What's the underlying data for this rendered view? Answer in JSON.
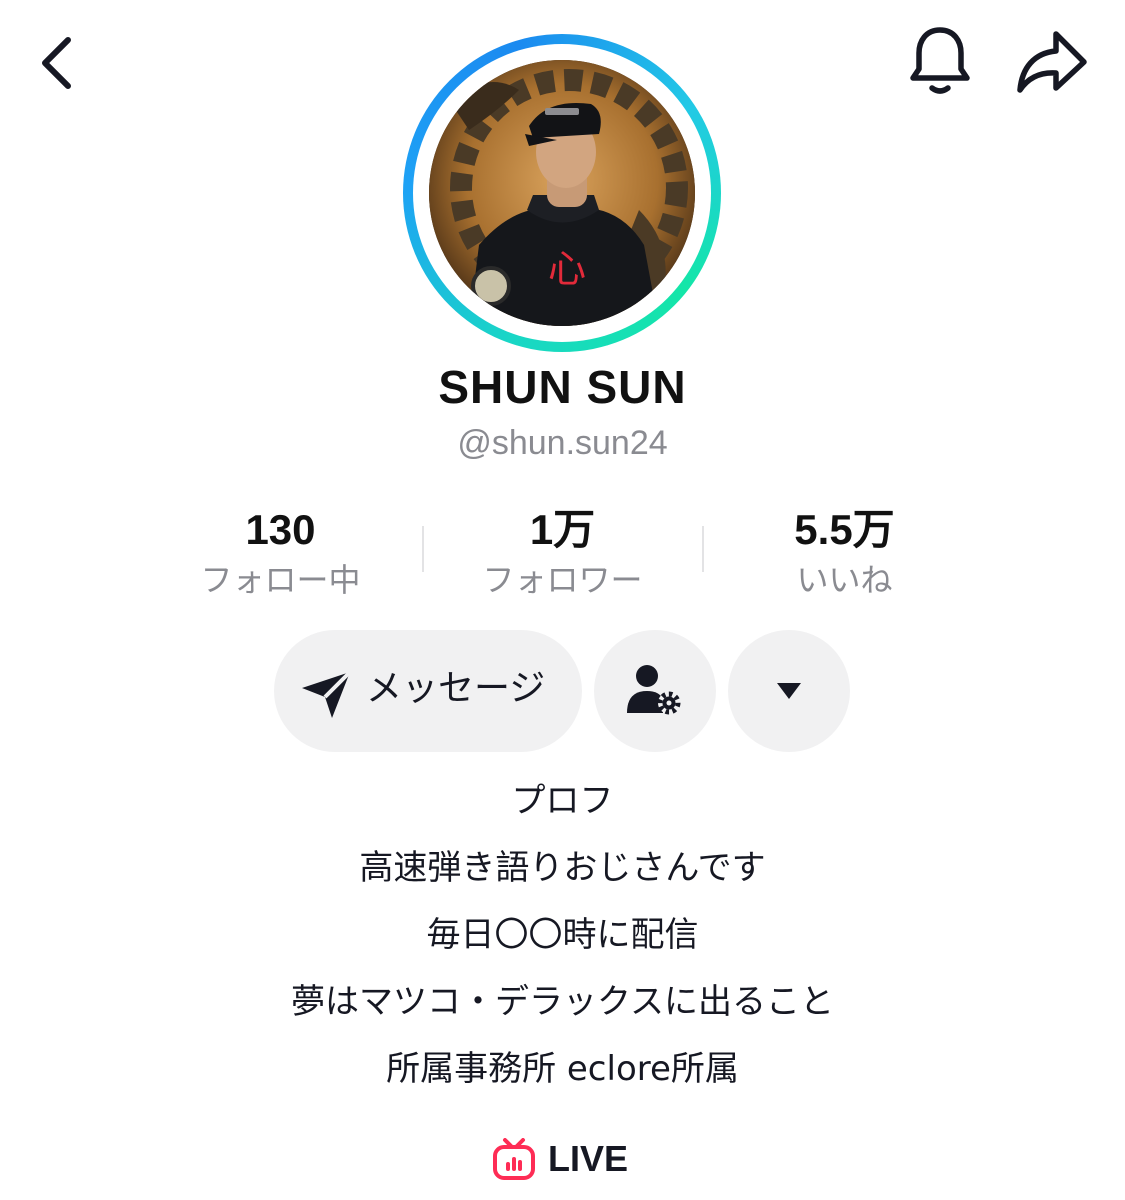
{
  "header": {
    "back_icon": "chevron-left-icon",
    "notification_icon": "bell-icon",
    "share_icon": "share-arrow-icon"
  },
  "profile": {
    "display_name": "SHUN SUN",
    "handle": "@shun.sun24",
    "avatar_ring_colors": [
      "#1ea2f5",
      "#14e6a8"
    ],
    "avatar_emblem": "心"
  },
  "stats": [
    {
      "value": "130",
      "label": "フォロー中"
    },
    {
      "value": "1万",
      "label": "フォロワー"
    },
    {
      "value": "5.5万",
      "label": "いいね"
    }
  ],
  "actions": {
    "message_label": "メッセージ",
    "message_icon": "send-icon",
    "friends_icon": "user-settings-icon",
    "more_icon": "caret-down-icon"
  },
  "bio": [
    "プロフ",
    "高速弾き語りおじさんです",
    "毎日〇〇時に配信",
    "夢はマツコ・デラックスに出ること",
    "所属事務所 eclore所属"
  ],
  "live": {
    "label": "LIVE",
    "icon": "live-tv-icon",
    "icon_color": "#fe2c55"
  },
  "colors": {
    "text_primary": "#161823",
    "text_secondary": "#8a8b91",
    "button_bg": "#f1f1f2",
    "accent": "#fe2c55"
  }
}
